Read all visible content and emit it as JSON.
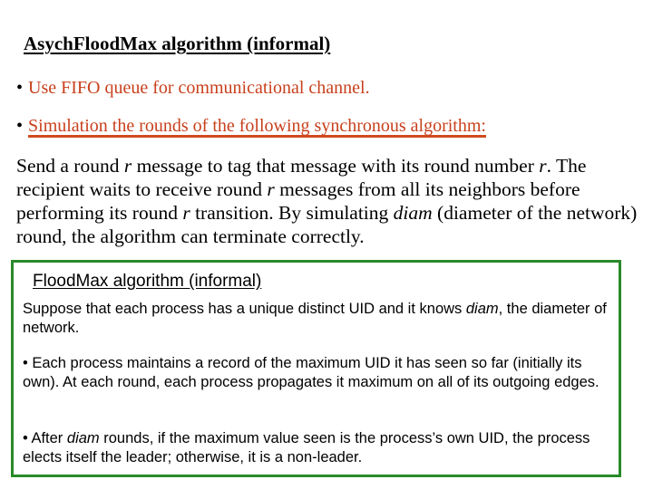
{
  "title": "AsychFloodMax algorithm (informal)",
  "bullets": [
    {
      "marker": "•",
      "text": "Use FIFO queue for communicational channel."
    },
    {
      "marker": "•",
      "text": "Simulation the rounds of the following synchronous algorithm:"
    }
  ],
  "paragraph": {
    "s1": "Send a round ",
    "r1": "r",
    "s2": " message to tag that message with its round number ",
    "r2": "r",
    "s3": ". The recipient waits to receive round ",
    "r3": "r",
    "s4": " messages from all its neighbors before performing its round ",
    "r4": "r",
    "s5": " transition. By simulating ",
    "diam": "diam",
    "s6": " (diameter of the network) round, the algorithm can terminate correctly."
  },
  "box": {
    "title": "FloodMax algorithm (informal)",
    "p1": {
      "a": "Suppose that each process has a unique distinct UID and it knows ",
      "diam": "diam",
      "b": ", the diameter of network."
    },
    "p2": "• Each process maintains a record of the maximum UID it has seen so far (initially its own). At each round, each process propagates it maximum on all of its outgoing edges.",
    "p3": {
      "a": "• After ",
      "diam": "diam",
      "b": " rounds, if the maximum value seen is the process’s own UID, the process elects itself the leader; otherwise, it is a non-leader."
    }
  },
  "colors": {
    "bullet_text": "#c8401c",
    "box_border": "#2a8a2a"
  }
}
